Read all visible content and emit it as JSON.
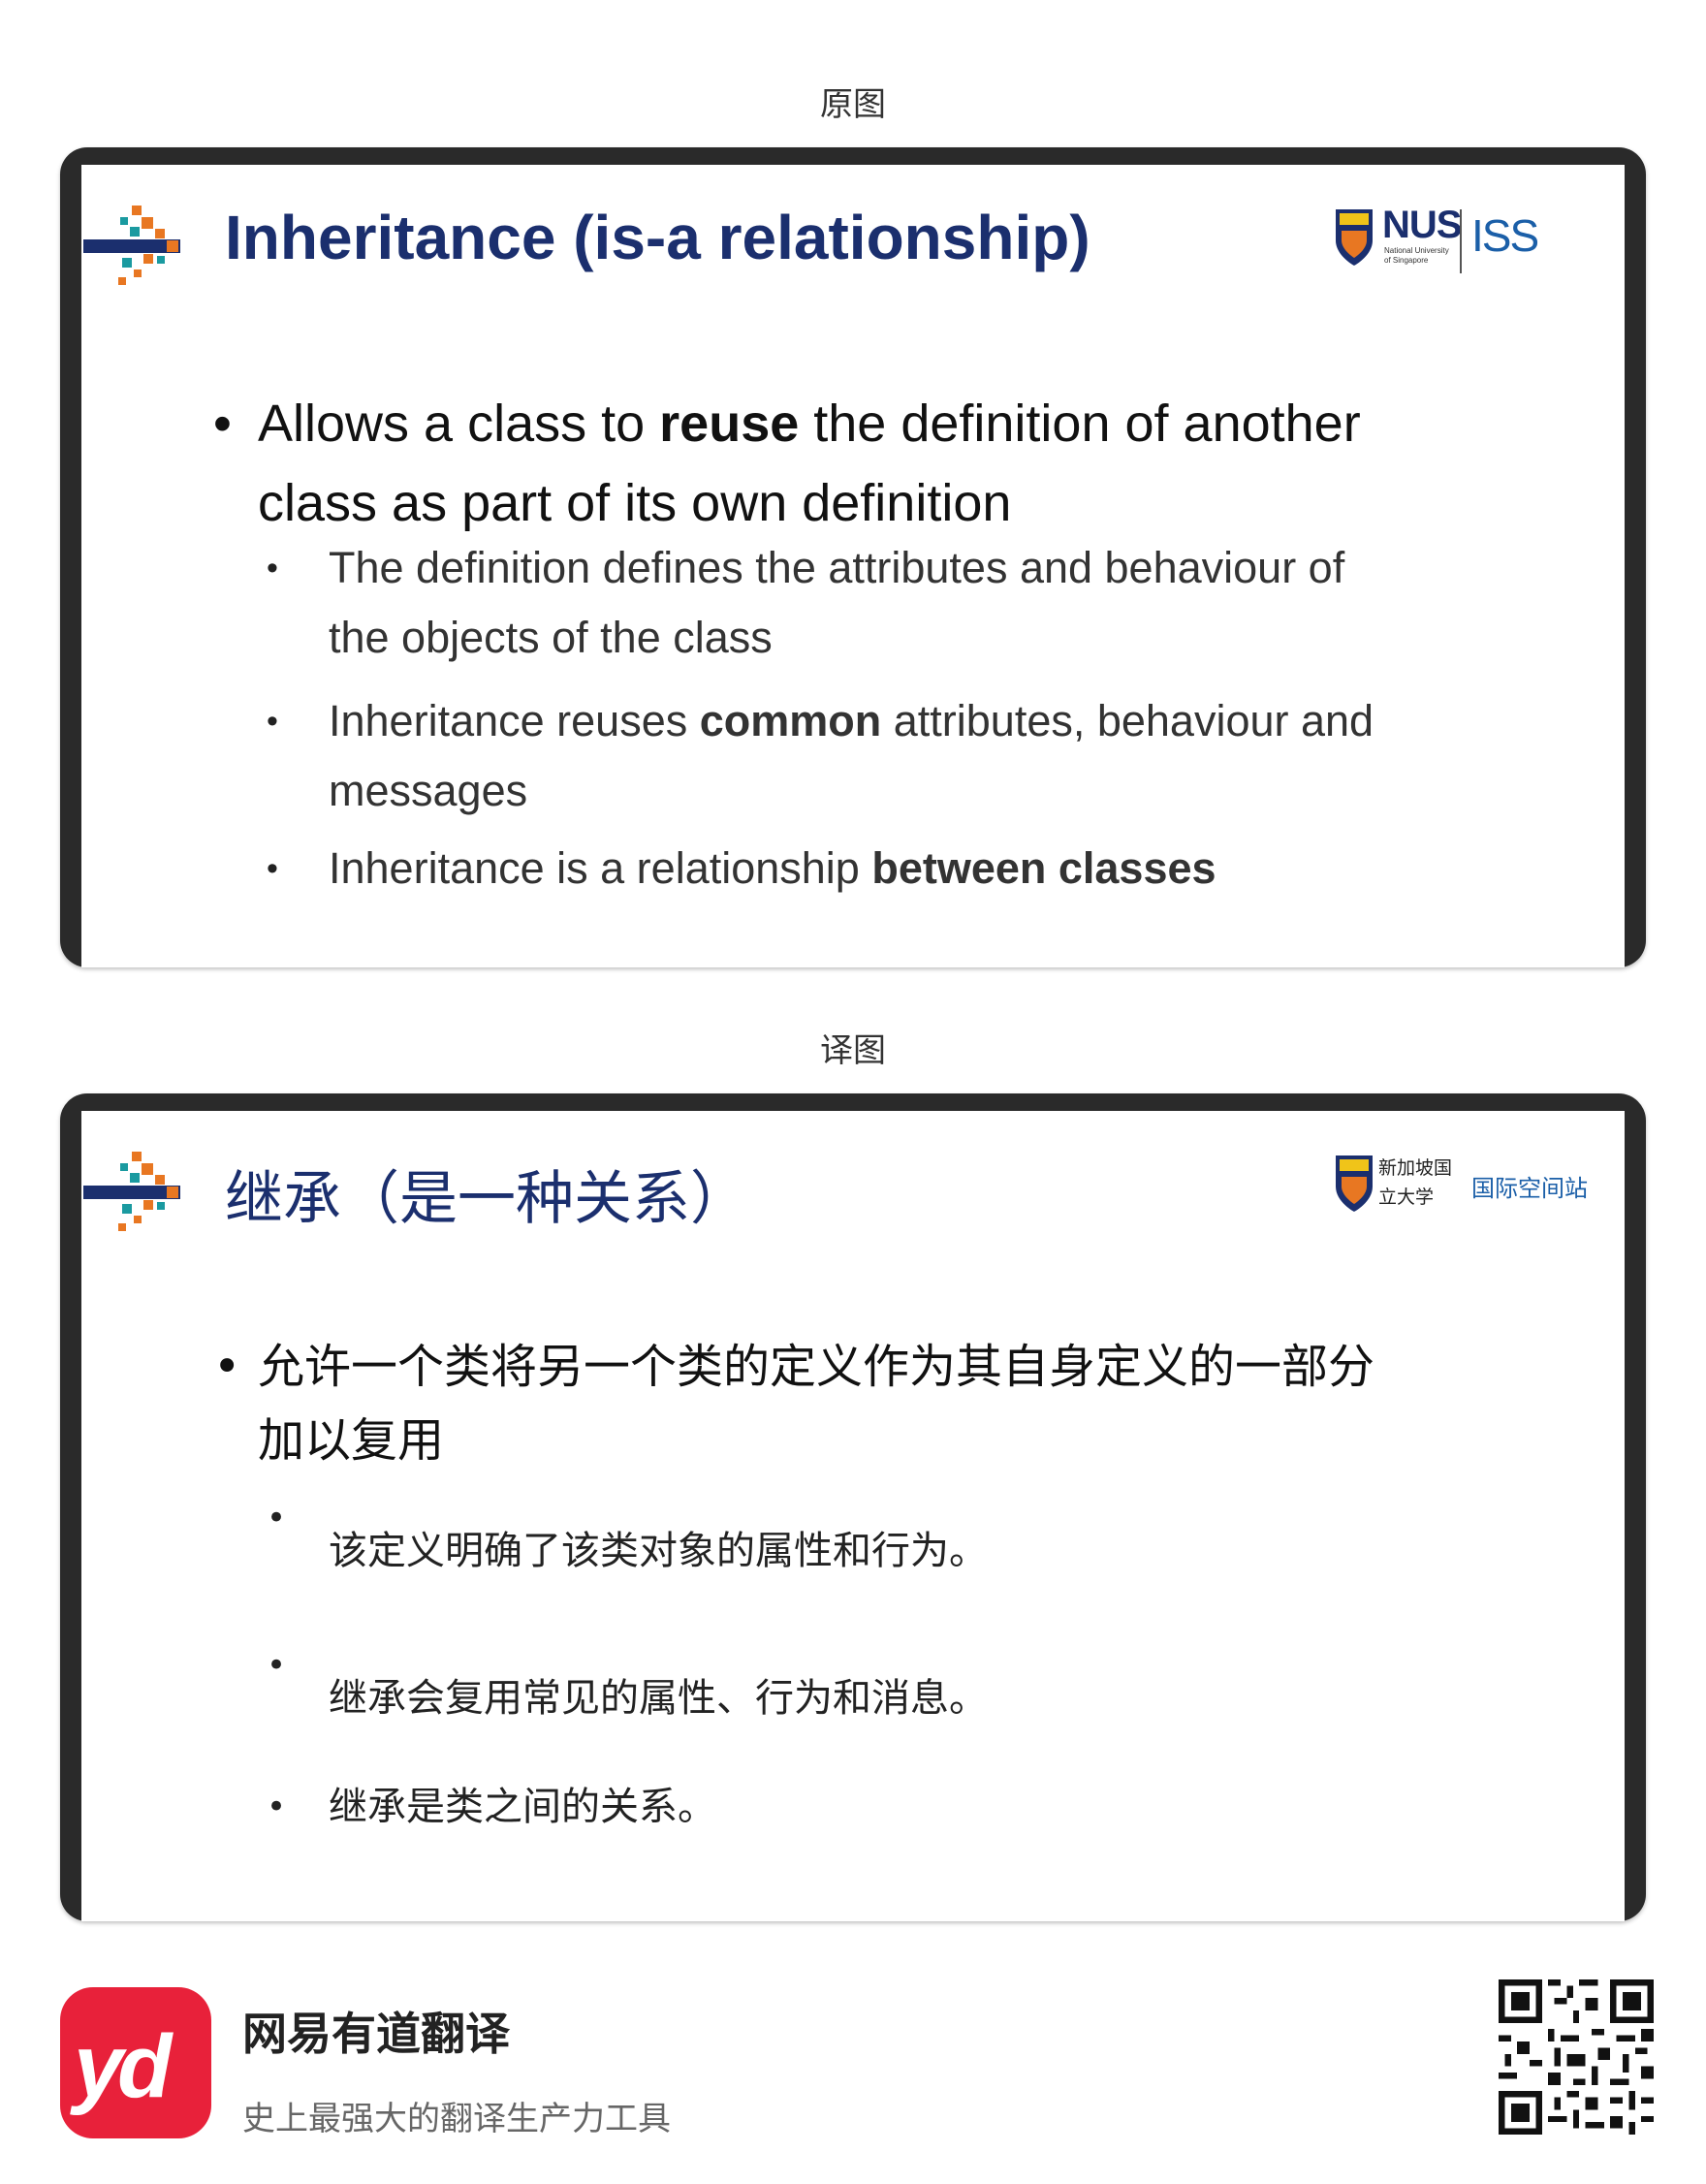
{
  "original": {
    "section_label": "原图",
    "title": "Inheritance (is-a relationship)",
    "logo": {
      "nus": "NUS",
      "nus_sub_1": "National University",
      "nus_sub_2": "of Singapore",
      "iss": "ISS"
    },
    "bullet_main": {
      "pre": "Allows a class to ",
      "bold": "reuse",
      "post": " the definition of another",
      "line2": "class as part of its own definition"
    },
    "sub_bullets": [
      {
        "line1": "The definition defines the attributes and behaviour of",
        "line2": "the objects of the class"
      },
      {
        "pre": "Inheritance reuses ",
        "bold": "common",
        "post": " attributes, behaviour and",
        "line2": "messages"
      },
      {
        "pre": "Inheritance is a relationship ",
        "bold": "between classes"
      }
    ]
  },
  "translated": {
    "section_label": "译图",
    "title": "继承（是一种关系）",
    "logo": {
      "uni_line1": "新加坡国",
      "uni_line2": "立大学",
      "iss": "国际空间站"
    },
    "bullet_main": {
      "line1": "允许一个类将另一个类的定义作为其自身定义的一部分",
      "line2": "加以复用"
    },
    "sub_bullets": [
      "该定义明确了该类对象的属性和行为。",
      "继承会复用常见的属性、行为和消息。",
      "继承是类之间的关系。"
    ]
  },
  "footer": {
    "logo_text": "yd",
    "app_name": "网易有道翻译",
    "slogan": "史上最强大的翻译生产力工具"
  },
  "bullet_char": "•",
  "colors": {
    "title_blue": "#1b2f6e",
    "iss_blue": "#1b5fa8",
    "logo_orange": "#e87722",
    "logo_teal": "#1a9aa0",
    "brand_red": "#e8213a"
  }
}
